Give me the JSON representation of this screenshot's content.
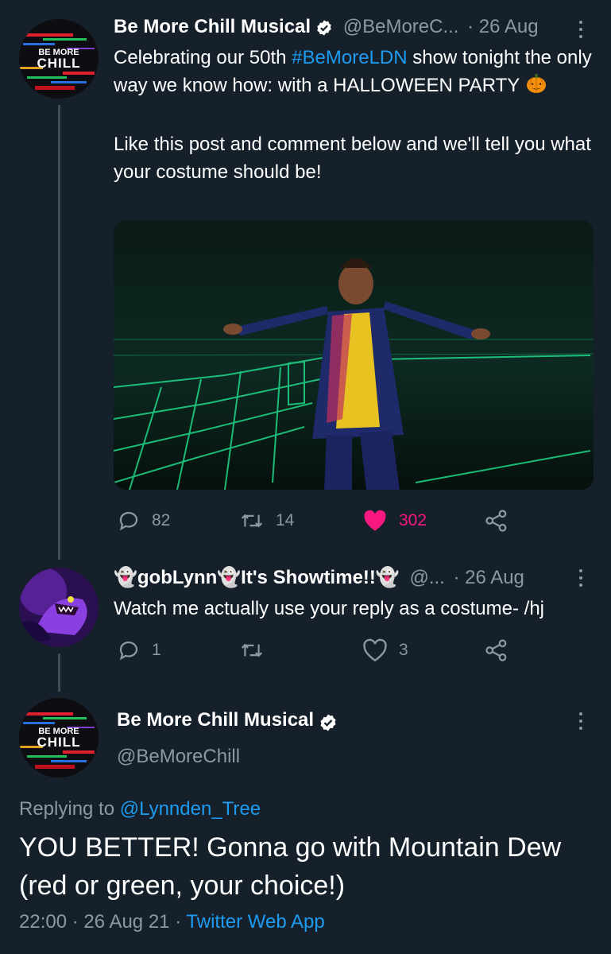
{
  "colors": {
    "background": "#15202b",
    "text": "#ffffff",
    "muted": "#8b98a5",
    "link": "#1d9bf0",
    "like_active": "#f91880",
    "thread_line": "#3d4c5b"
  },
  "tweet1": {
    "display_name": "Be More Chill Musical",
    "handle": "@BeMoreC...",
    "time": "· 26 Aug",
    "avatar_text": [
      "BE MORE",
      "CHILL"
    ],
    "text_parts": {
      "p1a": "Celebrating our 50th ",
      "hashtag": "#BeMoreLDN",
      "p1b": " show tonight the only way we know how: with a HALLOWEEN PARTY",
      "emoji": "🎃",
      "p2": "Like this post and comment below and we'll tell you what your costume should be!"
    },
    "actions": {
      "replies": "82",
      "retweets": "14",
      "likes": "302",
      "liked": true
    }
  },
  "tweet2": {
    "display_name": "👻gobLynn👻It's Showtime!!👻",
    "handle": "@...",
    "time": "· 26 Aug",
    "text": "Watch me actually use your reply as a costume- /hj",
    "actions": {
      "replies": "1",
      "retweets": "",
      "likes": "3",
      "liked": false
    }
  },
  "main_tweet": {
    "display_name": "Be More Chill Musical",
    "handle": "@BeMoreChill",
    "avatar_text": [
      "BE MORE",
      "CHILL"
    ],
    "replying_to_label": "Replying to",
    "replying_to_handle": "@Lynnden_Tree",
    "text": "YOU BETTER! Gonna go with Mountain Dew (red or green, your choice!)",
    "time": "22:00",
    "date": "26 Aug 21",
    "source": "Twitter Web App",
    "separator": "·"
  },
  "icons": [
    "verified-badge-icon",
    "more-icon",
    "reply-icon",
    "retweet-icon",
    "heart-icon",
    "share-icon",
    "pumpkin-emoji"
  ]
}
